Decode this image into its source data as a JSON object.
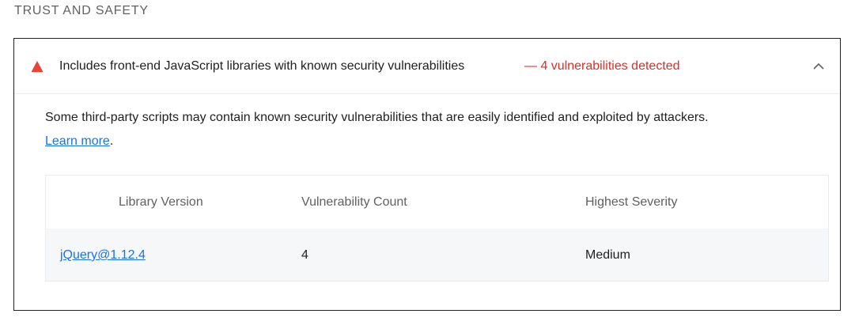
{
  "section": {
    "title": "TRUST AND SAFETY"
  },
  "audit": {
    "title": "Includes front-end JavaScript libraries with known security vulnerabilities",
    "display_value": "— 4 vulnerabilities detected",
    "status_color": "#d93025",
    "icon": "fail-triangle-icon",
    "expanded": true,
    "description_text": "Some third-party scripts may contain known security vulnerabilities that are easily identified and exploited by attackers.",
    "learn_more_label": "Learn more",
    "description_trailing": "."
  },
  "table": {
    "headers": [
      "Library Version",
      "Vulnerability Count",
      "Highest Severity"
    ],
    "rows": [
      {
        "library": "jQuery@1.12.4",
        "count": "4",
        "severity": "Medium"
      }
    ]
  }
}
